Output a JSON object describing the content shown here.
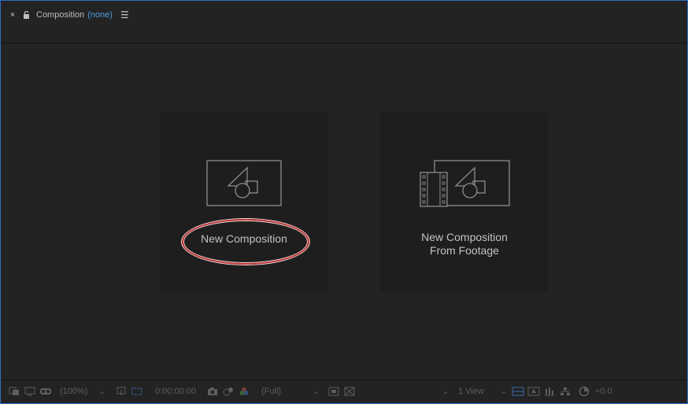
{
  "panel": {
    "close_label": "×",
    "title": "Composition",
    "comp_name": "(none)",
    "menu_label": "☰"
  },
  "cards": [
    {
      "label_line1": "New Composition",
      "label_line2": ""
    },
    {
      "label_line1": "New Composition",
      "label_line2": "From Footage"
    }
  ],
  "bottom_bar": {
    "magnification": "(100%)",
    "timecode": "0:00:00:00",
    "resolution": "(Full)",
    "views": "1 View",
    "exposure": "+0.0"
  },
  "colors": {
    "accent": "#4d9de0",
    "panel_border": "#2d6dc4",
    "background": "#232323",
    "card_background": "#1e1e1e",
    "highlight": "#c23a3a"
  }
}
